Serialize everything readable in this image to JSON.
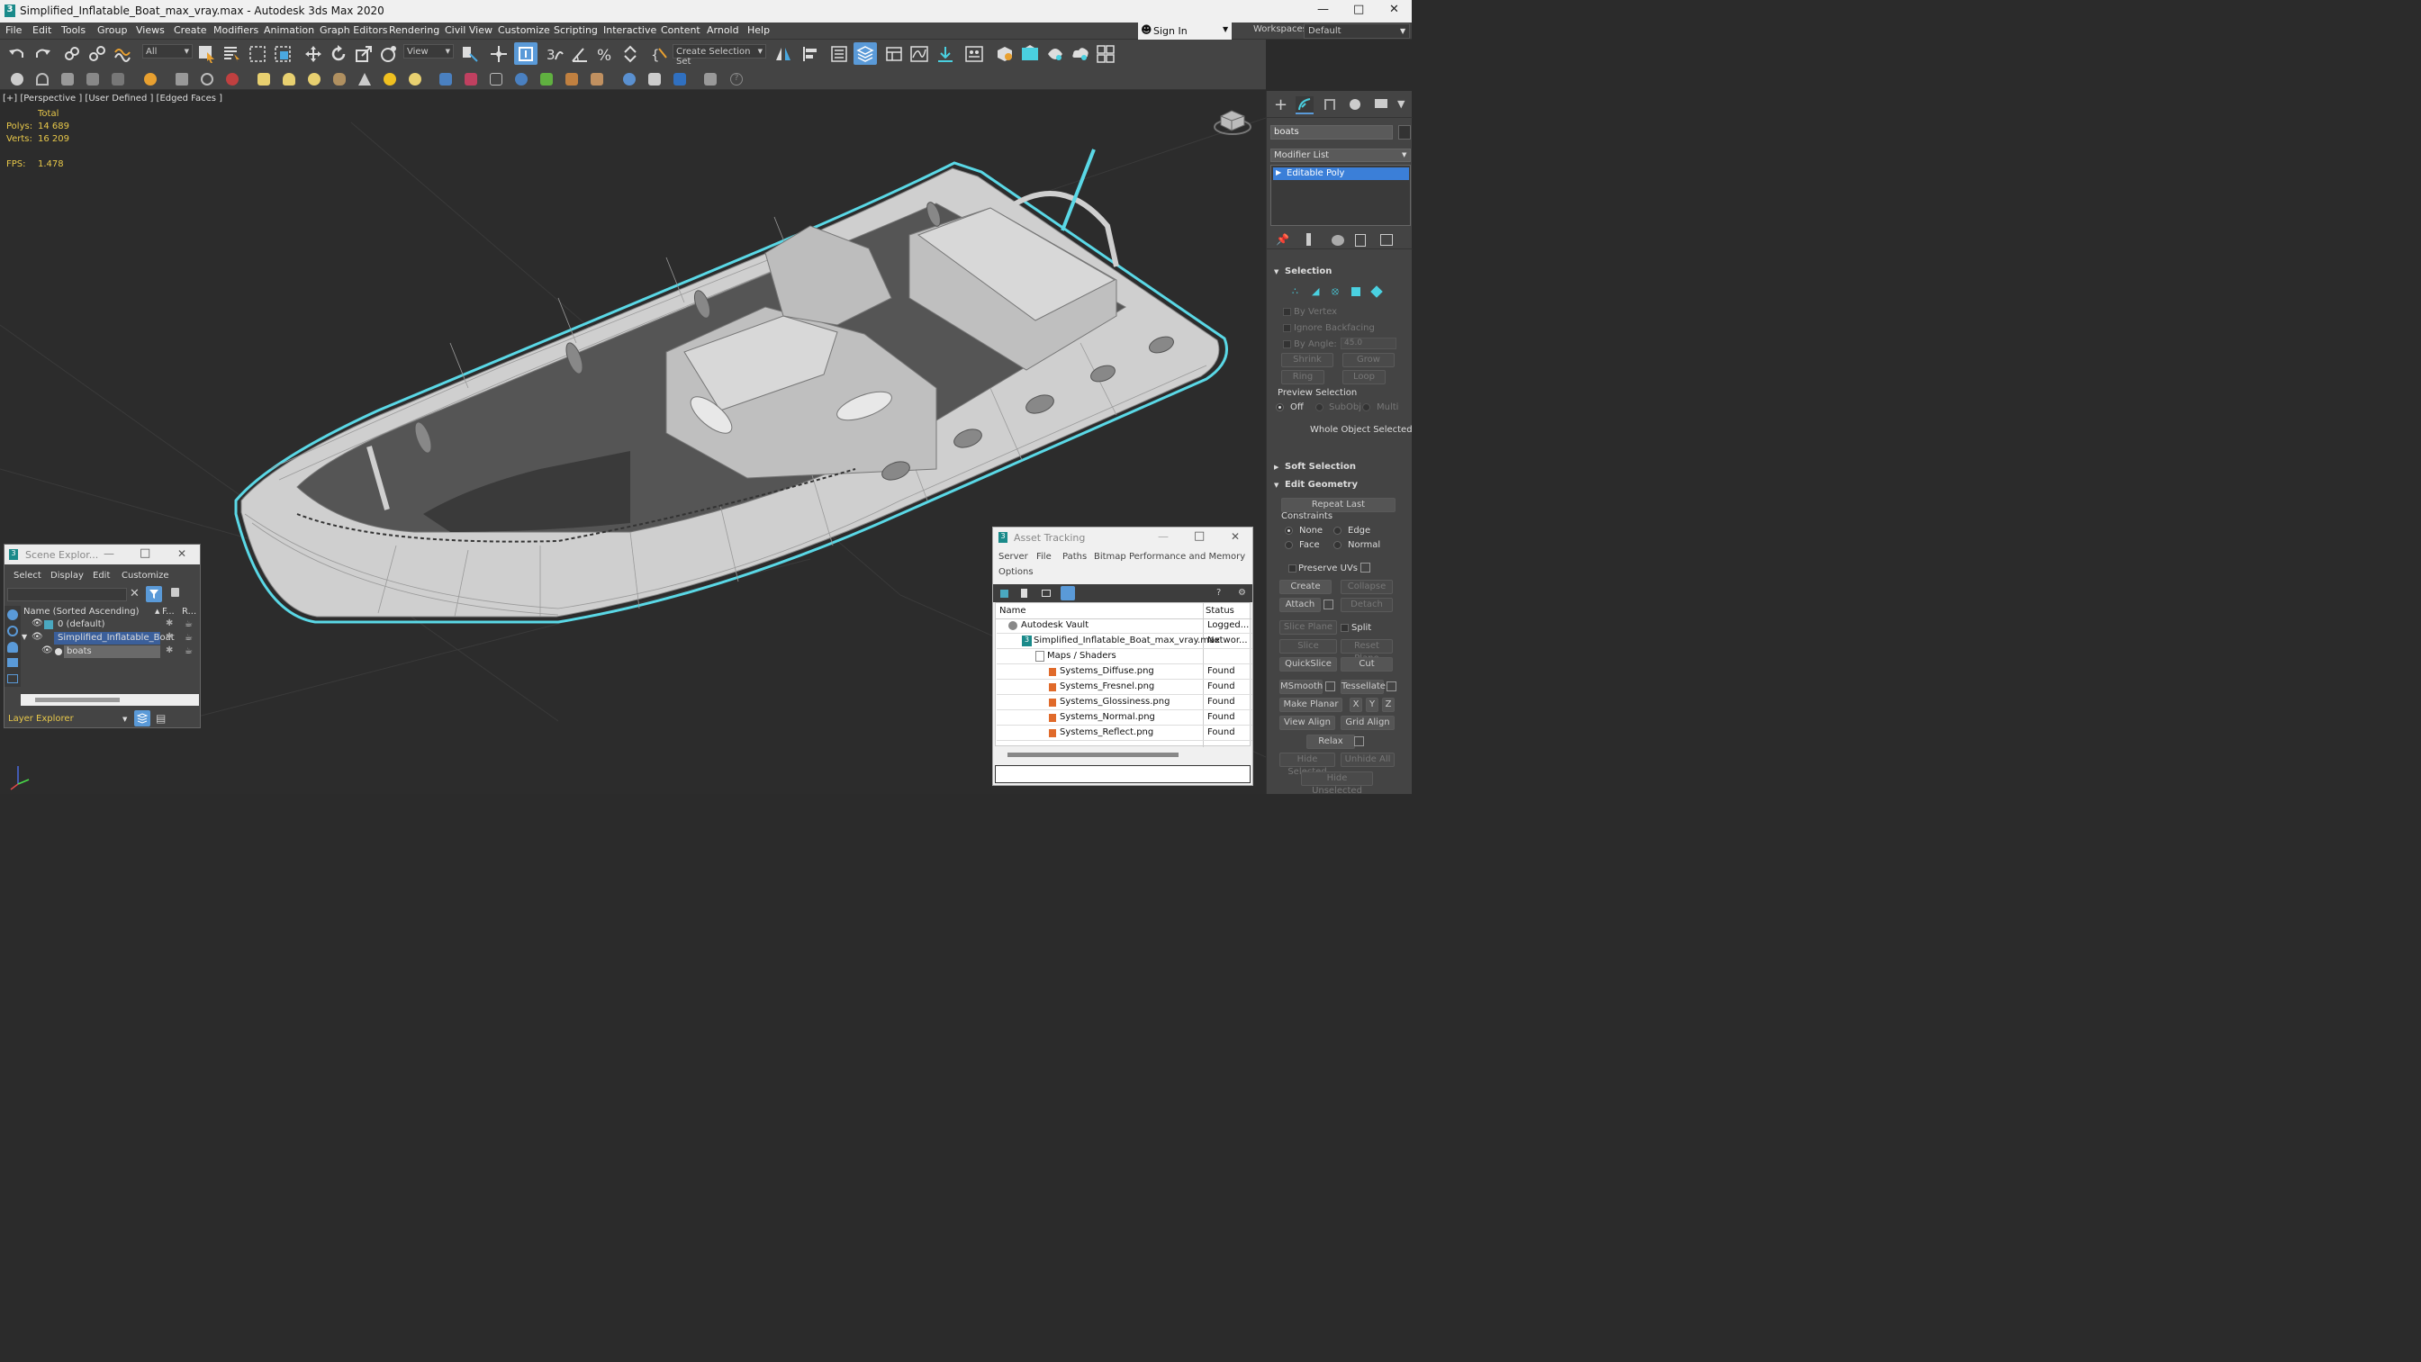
{
  "title": "Simplified_Inflatable_Boat_max_vray.max - Autodesk 3ds Max 2020",
  "menu": [
    "File",
    "Edit",
    "Tools",
    "Group",
    "Views",
    "Create",
    "Modifiers",
    "Animation",
    "Graph Editors",
    "Rendering",
    "Civil View",
    "Customize",
    "Scripting",
    "Interactive",
    "Content",
    "Arnold",
    "Help"
  ],
  "signin": "Sign In",
  "workspaces_label": "Workspaces:",
  "workspace_value": "Default",
  "toolbar": {
    "filter": "All",
    "view": "View",
    "selection_set": "Create Selection Set"
  },
  "viewport": {
    "label": "[+] [Perspective ] [User Defined ] [Edged Faces ]",
    "stats": {
      "total_label": "Total",
      "polys_label": "Polys:",
      "polys": "14 689",
      "verts_label": "Verts:",
      "verts": "16 209",
      "fps_label": "FPS:",
      "fps": "1.478"
    }
  },
  "cmdpanel": {
    "object_name": "boats",
    "modifier_list": "Modifier List",
    "stack_item": "Editable Poly",
    "selection": {
      "title": "Selection",
      "by_vertex": "By Vertex",
      "ignore_backfacing": "Ignore Backfacing",
      "by_angle": "By Angle:",
      "angle_value": "45.0",
      "shrink": "Shrink",
      "grow": "Grow",
      "ring": "Ring",
      "loop": "Loop",
      "preview_selection": "Preview Selection",
      "off": "Off",
      "subobj": "SubObj",
      "multi": "Multi",
      "whole_object": "Whole Object Selected"
    },
    "soft_selection": "Soft Selection",
    "edit_geometry": {
      "title": "Edit Geometry",
      "repeat_last": "Repeat Last",
      "constraints": "Constraints",
      "none": "None",
      "edge": "Edge",
      "face": "Face",
      "normal": "Normal",
      "preserve_uvs": "Preserve UVs",
      "create": "Create",
      "collapse": "Collapse",
      "attach": "Attach",
      "detach": "Detach",
      "slice_plane": "Slice Plane",
      "split": "Split",
      "slice": "Slice",
      "reset_plane": "Reset Plane",
      "quickslice": "QuickSlice",
      "cut": "Cut",
      "msmooth": "MSmooth",
      "tessellate": "Tessellate",
      "make_planar": "Make Planar",
      "x": "X",
      "y": "Y",
      "z": "Z",
      "view_align": "View Align",
      "grid_align": "Grid Align",
      "relax": "Relax",
      "hide_selected": "Hide Selected",
      "unhide_all": "Unhide All",
      "hide_unselected": "Hide Unselected"
    }
  },
  "scene_explorer": {
    "title": "Scene Explor...",
    "menu": [
      "Select",
      "Display",
      "Edit",
      "Customize"
    ],
    "col_name": "Name (Sorted Ascending)",
    "col_f": "F...",
    "col_r": "R...",
    "rows": [
      "0 (default)",
      "Simplified_Inflatable_Boat",
      "boats"
    ],
    "footer": "Layer Explorer"
  },
  "asset_tracking": {
    "title": "Asset Tracking",
    "menu": [
      "Server",
      "File",
      "Paths",
      "Bitmap Performance and Memory"
    ],
    "menu2": "Options",
    "col_name": "Name",
    "col_status": "Status",
    "rows": [
      {
        "name": "Autodesk Vault",
        "status": "Logged..."
      },
      {
        "name": "Simplified_Inflatable_Boat_max_vray.max",
        "status": "Networ..."
      },
      {
        "name": "Maps / Shaders",
        "status": ""
      },
      {
        "name": "Systems_Diffuse.png",
        "status": "Found"
      },
      {
        "name": "Systems_Fresnel.png",
        "status": "Found"
      },
      {
        "name": "Systems_Glossiness.png",
        "status": "Found"
      },
      {
        "name": "Systems_Normal.png",
        "status": "Found"
      },
      {
        "name": "Systems_Reflect.png",
        "status": "Found"
      }
    ]
  },
  "colors": {
    "accent": "#5ad8e6",
    "stats_yellow": "#e8c84a",
    "selection_blue": "#3b7fd8"
  }
}
